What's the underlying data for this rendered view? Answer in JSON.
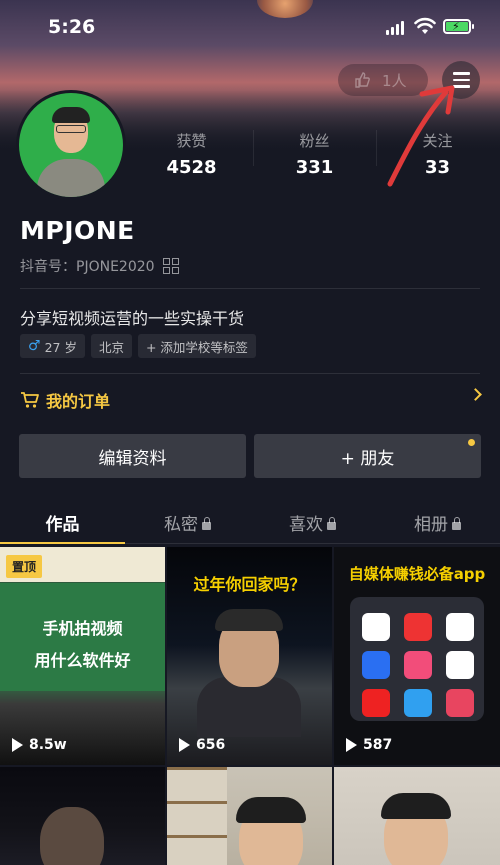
{
  "status_bar": {
    "time": "5:26"
  },
  "header": {
    "visitor_count": "1人"
  },
  "profile": {
    "nickname": "MPJONE",
    "douyin_id": "抖音号：PJONE2020",
    "bio": "分享短视频运营的一些实操干货",
    "stats": [
      {
        "label": "获赞",
        "value": "4528"
      },
      {
        "label": "粉丝",
        "value": "331"
      },
      {
        "label": "关注",
        "value": "33"
      }
    ],
    "tags": [
      {
        "text": "27 岁",
        "icon": "male-icon"
      },
      {
        "text": "北京"
      },
      {
        "text": "+ 添加学校等标签"
      }
    ]
  },
  "orders": {
    "label": "我的订单"
  },
  "actions": {
    "edit_label": "编辑资料",
    "friend_label": "+ 朋友"
  },
  "tabs": [
    {
      "label": "作品",
      "active": true
    },
    {
      "label": "私密",
      "locked": true
    },
    {
      "label": "喜欢",
      "locked": true
    },
    {
      "label": "相册",
      "locked": true
    }
  ],
  "videos": [
    {
      "pinned_label": "置顶",
      "overlay_lines": [
        "手机拍视频",
        "用什么软件好"
      ],
      "plays": "8.5w"
    },
    {
      "overlay_title": "过年你回家吗？",
      "plays": "656"
    },
    {
      "overlay_title": "自媒体赚钱必备app",
      "plays": "587"
    },
    {},
    {},
    {}
  ],
  "colors": {
    "accent": "#f6c843",
    "background": "#161823",
    "button": "#393b44"
  }
}
